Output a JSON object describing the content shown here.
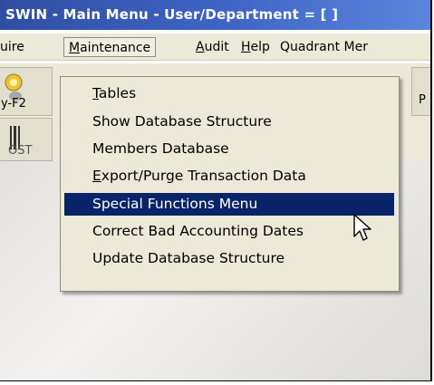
{
  "title": "SWIN - Main Menu - User/Department = [ ]",
  "menubar": {
    "items": [
      {
        "label": "uire"
      },
      {
        "label": "Maintenance",
        "mnemonic": "M",
        "rest": "aintenance"
      },
      {
        "label": "Audit",
        "mnemonic": "A",
        "rest": "udit"
      },
      {
        "label": "Help",
        "mnemonic": "H",
        "rest": "elp"
      },
      {
        "label": "Quadrant Mer"
      }
    ]
  },
  "toolbar": {
    "left_label_1": "y-F2",
    "left_label_2": "OST",
    "right_label": "P"
  },
  "dropdown": {
    "items": [
      {
        "label": "Tables",
        "mnemonic": "T",
        "rest": "ables"
      },
      {
        "label": "Show Database Structure"
      },
      {
        "label": "Members Database"
      },
      {
        "label": "Export/Purge Transaction Data",
        "mnemonic": "E",
        "rest": "xport/Purge Transaction Data"
      },
      {
        "label": "Special Functions Menu",
        "selected": true
      },
      {
        "label": "Correct Bad Accounting Dates"
      },
      {
        "label": "Update Database Structure"
      }
    ],
    "selected_bg": "#0a246a",
    "selected_fg": "#ffffff"
  },
  "colors": {
    "titlebar": "#3f66c6",
    "menubar": "#ece9d8",
    "menu_bg": "#ece9d8"
  }
}
